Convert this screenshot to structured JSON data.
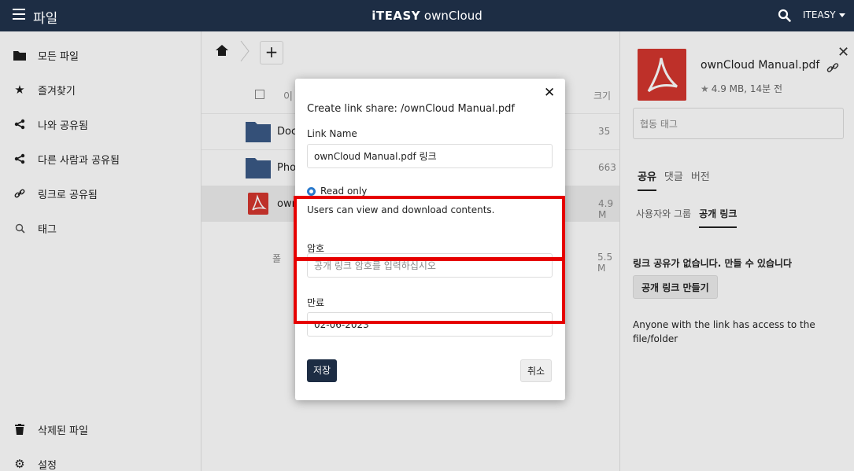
{
  "header": {
    "app_name": "파일",
    "brand_prefix": "iTEASY",
    "brand_suffix": " ownCloud",
    "user": "ITEASY"
  },
  "sidebar": {
    "items": [
      {
        "label": "모든 파일",
        "icon": "folder-icon"
      },
      {
        "label": "즐겨찾기",
        "icon": "star-icon"
      },
      {
        "label": "나와 공유됨",
        "icon": "share-icon"
      },
      {
        "label": "다른 사람과 공유됨",
        "icon": "share-icon"
      },
      {
        "label": "링크로 공유됨",
        "icon": "link-icon"
      },
      {
        "label": "태그",
        "icon": "tag-icon"
      }
    ],
    "bottom": [
      {
        "label": "삭제된 파일",
        "icon": "trash-icon"
      },
      {
        "label": "설정",
        "icon": "gear-icon"
      }
    ]
  },
  "file_list": {
    "column_name": "이",
    "column_size": "크기",
    "rows": [
      {
        "name": "Doc",
        "size": "35",
        "type": "folder"
      },
      {
        "name": "Pho",
        "size": "663",
        "type": "folder"
      },
      {
        "name": "own",
        "size": "4.9 M",
        "type": "pdf"
      }
    ],
    "summary": "폴",
    "summary_size": "5.5 M"
  },
  "details": {
    "filename": "ownCloud Manual.pdf",
    "meta": "4.9 MB, 14분 전",
    "tags_placeholder": "협동 태그",
    "tabs": [
      "공유",
      "댓글",
      "버전"
    ],
    "subtabs": [
      "사용자와 그룹",
      "공개 링크"
    ],
    "no_link_message": "링크 공유가 없습니다. 만들 수 있습니다",
    "create_link_label": "공개 링크 만들기",
    "anyone_message": "Anyone with the link has access to the file/folder"
  },
  "modal": {
    "title": "Create link share: /ownCloud Manual.pdf",
    "link_name_label": "Link Name",
    "link_name_value": "ownCloud Manual.pdf 링크",
    "permission_label": "Read only",
    "permission_desc": "Users can view and download contents.",
    "password_label": "암호",
    "password_placeholder": "공개 링크 암호를 입력하십시오",
    "expiry_label": "만료",
    "expiry_value": "02-06-2023",
    "save_label": "저장",
    "cancel_label": "취소"
  },
  "colors": {
    "header_bg": "#1d2d44",
    "highlight": "#e60000",
    "pdf_red": "#d4362e",
    "folder_blue": "#3a5a86"
  }
}
